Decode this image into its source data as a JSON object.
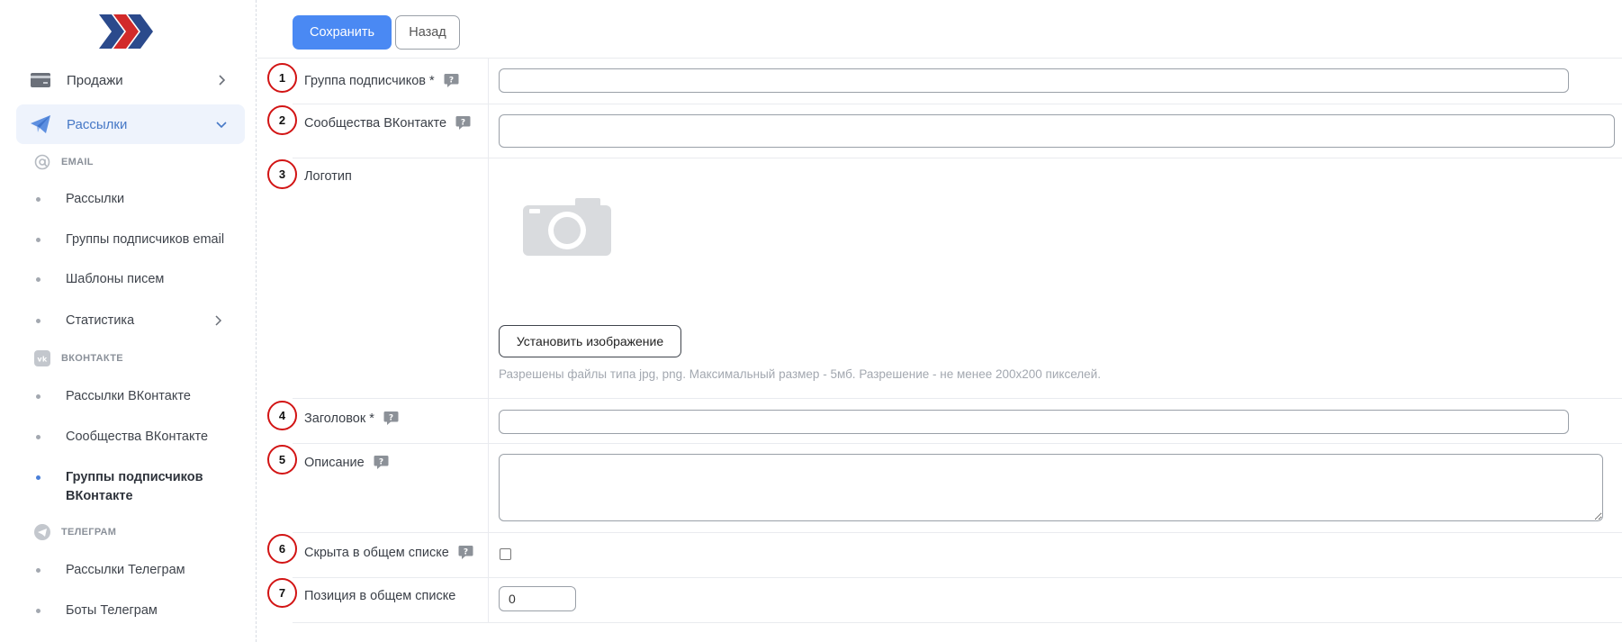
{
  "colors": {
    "accent": "#4a89f3",
    "active_bg": "#eef3fc",
    "active_text": "#4678c6",
    "marker": "#d21414"
  },
  "sidebar": {
    "sales": {
      "label": "Продажи",
      "icon": "credit-card-icon"
    },
    "mailings": {
      "label": "Рассылки",
      "icon": "paper-plane-icon"
    },
    "email_section": {
      "label": "EMAIL",
      "icon": "at-icon"
    },
    "email_items": [
      "Рассылки",
      "Группы подписчиков email",
      "Шаблоны писем",
      "Статистика"
    ],
    "vk_section": {
      "label": "ВКОНТАКТЕ",
      "icon": "vk-icon"
    },
    "vk_items": [
      "Рассылки ВКонтакте",
      "Сообщества ВКонтакте",
      "Группы подписчиков ВКонтакте"
    ],
    "tg_section": {
      "label": "ТЕЛЕГРАМ",
      "icon": "telegram-icon"
    },
    "tg_items": [
      "Рассылки Телеграм",
      "Боты Телеграм"
    ]
  },
  "toolbar": {
    "save_label": "Сохранить",
    "back_label": "Назад"
  },
  "form": {
    "subscriber_group": {
      "marker": "1",
      "label": "Группа подписчиков *",
      "value": ""
    },
    "vk_communities": {
      "marker": "2",
      "label": "Сообщества ВКонтакте",
      "value": ""
    },
    "logo": {
      "marker": "3",
      "label": "Логотип",
      "button_label": "Установить изображение",
      "hint": "Разрешены файлы типа jpg, png. Максимальный размер - 5мб. Разрешение - не менее 200x200 пикселей."
    },
    "title": {
      "marker": "4",
      "label": "Заголовок *",
      "value": ""
    },
    "description": {
      "marker": "5",
      "label": "Описание",
      "value": ""
    },
    "hidden": {
      "marker": "6",
      "label": "Скрыта в общем списке",
      "checked": false
    },
    "position": {
      "marker": "7",
      "label": "Позиция в общем списке",
      "value": "0"
    }
  }
}
